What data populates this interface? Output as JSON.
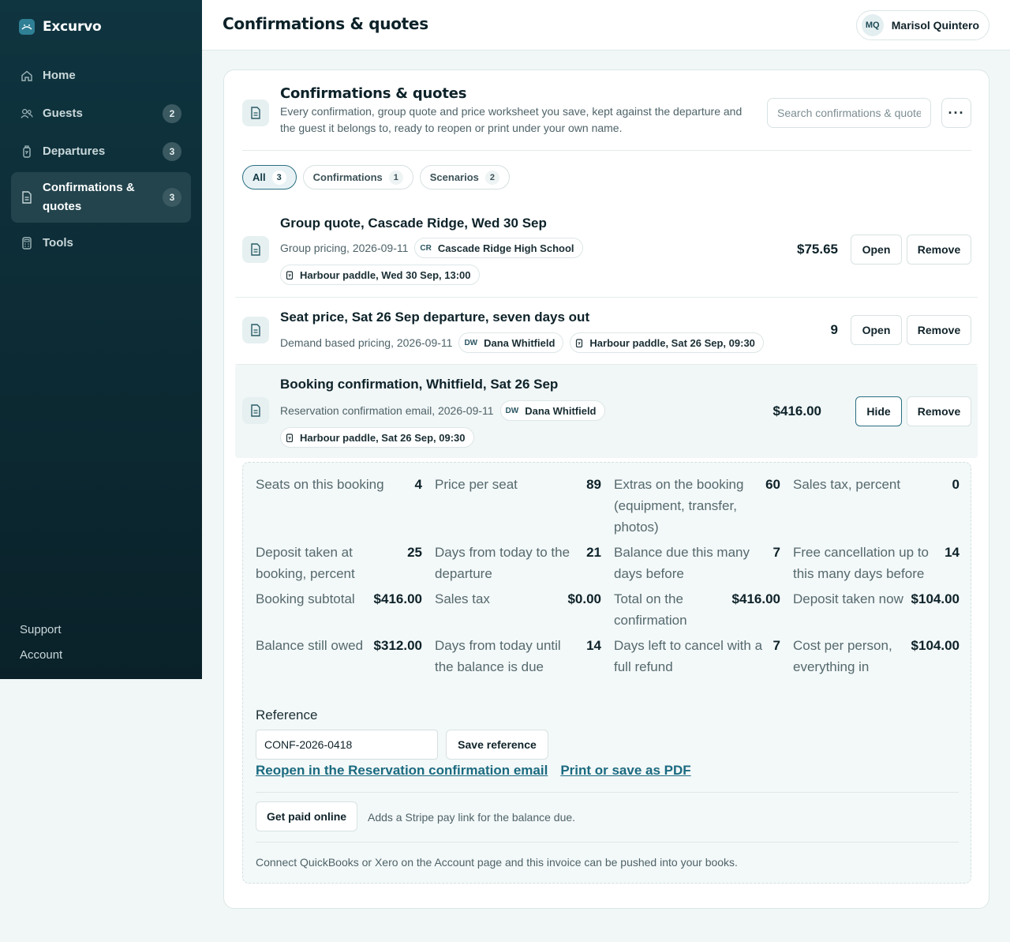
{
  "brand": {
    "name": "Excurvo"
  },
  "sidebar": {
    "items": [
      {
        "label": "Home",
        "icon": "home-icon",
        "badge": ""
      },
      {
        "label": "Guests",
        "icon": "users-icon",
        "badge": "2"
      },
      {
        "label": "Departures",
        "icon": "flask-icon",
        "badge": "3"
      },
      {
        "label": "Confirmations & quotes",
        "icon": "document-icon",
        "badge": "3"
      },
      {
        "label": "Tools",
        "icon": "calculator-icon",
        "badge": ""
      }
    ],
    "footer": {
      "support": "Support",
      "account": "Account"
    }
  },
  "header": {
    "title": "Confirmations & quotes",
    "user": {
      "initials": "MQ",
      "name": "Marisol Quintero"
    }
  },
  "panel": {
    "title": "Confirmations & quotes",
    "subtitle": "Every confirmation, group quote and price worksheet you save, kept against the departure and the guest it belongs to, ready to reopen or print under your own name.",
    "search_placeholder": "Search confirmations & quotes",
    "more": "···"
  },
  "filters": [
    {
      "label": "All",
      "count": "3"
    },
    {
      "label": "Confirmations",
      "count": "1"
    },
    {
      "label": "Scenarios",
      "count": "2"
    }
  ],
  "rows": [
    {
      "title": "Group quote, Cascade Ridge, Wed 30 Sep",
      "meta": "Group pricing, 2026-09-11",
      "guest_initials": "CR",
      "guest": "Cascade Ridge High School",
      "departure": "Harbour paddle, Wed 30 Sep, 13:00",
      "amount": "$75.65",
      "action": "Open",
      "remove": "Remove"
    },
    {
      "title": "Seat price, Sat 26 Sep departure, seven days out",
      "meta": "Demand based pricing, 2026-09-11",
      "guest_initials": "DW",
      "guest": "Dana Whitfield",
      "departure": "Harbour paddle, Sat 26 Sep, 09:30",
      "amount": "9",
      "action": "Open",
      "remove": "Remove"
    },
    {
      "title": "Booking confirmation, Whitfield, Sat 26 Sep",
      "meta": "Reservation confirmation email, 2026-09-11",
      "guest_initials": "DW",
      "guest": "Dana Whitfield",
      "departure": "Harbour paddle, Sat 26 Sep, 09:30",
      "amount": "$416.00",
      "action": "Hide",
      "remove": "Remove"
    }
  ],
  "detail": {
    "fields": [
      {
        "label": "Seats on this booking",
        "value": "4"
      },
      {
        "label": "Price per seat",
        "value": "89"
      },
      {
        "label": "Extras on the booking (equipment, transfer, photos)",
        "value": "60"
      },
      {
        "label": "Sales tax, percent",
        "value": "0"
      },
      {
        "label": "Deposit taken at booking, percent",
        "value": "25"
      },
      {
        "label": "Days from today to the departure",
        "value": "21"
      },
      {
        "label": "Balance due this many days before",
        "value": "7"
      },
      {
        "label": "Free cancellation up to this many days before",
        "value": "14"
      },
      {
        "label": "Booking subtotal",
        "value": "$416.00"
      },
      {
        "label": "Sales tax",
        "value": "$0.00"
      },
      {
        "label": "Total on the confirmation",
        "value": "$416.00"
      },
      {
        "label": "Deposit taken now",
        "value": "$104.00"
      },
      {
        "label": "Balance still owed",
        "value": "$312.00"
      },
      {
        "label": "Days from today until the balance is due",
        "value": "14"
      },
      {
        "label": "Days left to cancel with a full refund",
        "value": "7"
      },
      {
        "label": "Cost per person, everything in",
        "value": "$104.00"
      }
    ],
    "reference_label": "Reference",
    "reference_value": "CONF-2026-0418",
    "save_reference": "Save reference",
    "reopen_link": "Reopen in the Reservation confirmation email",
    "print_link": "Print or save as PDF",
    "get_paid": "Get paid online",
    "get_paid_note": "Adds a Stripe pay link for the balance due.",
    "quickbooks_note": "Connect QuickBooks or Xero on the Account page and this invoice can be pushed into your books."
  }
}
